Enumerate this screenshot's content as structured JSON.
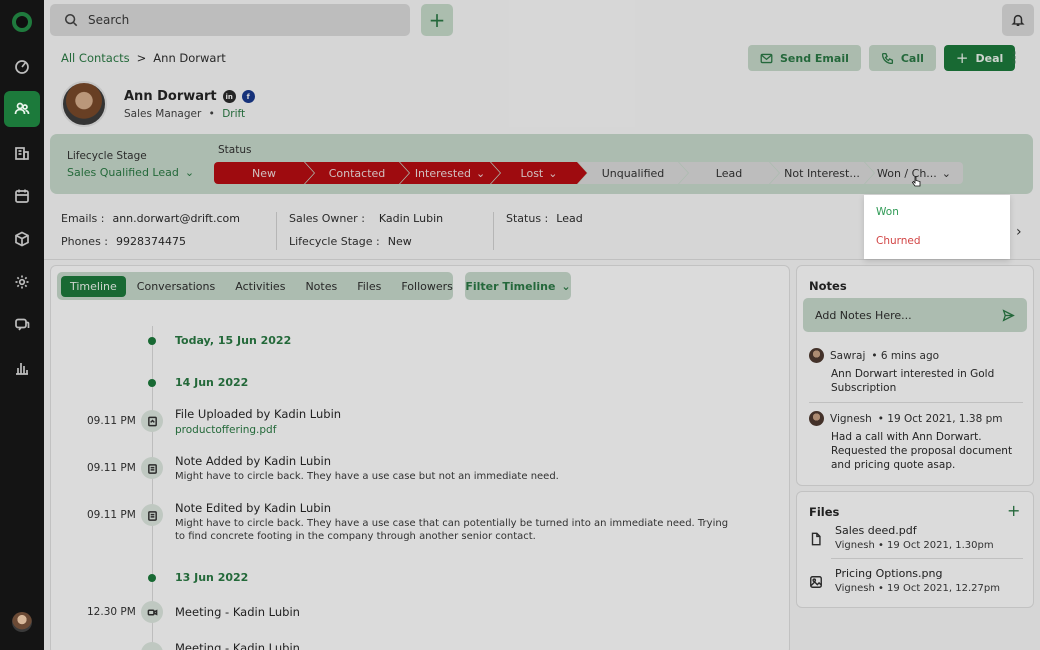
{
  "search": {
    "placeholder": "Search"
  },
  "breadcrumb": {
    "parent": "All Contacts",
    "separator": ">",
    "current": "Ann Dorwart"
  },
  "actions": {
    "send_email": "Send Email",
    "call": "Call",
    "deal": "Deal"
  },
  "contact": {
    "name": "Ann Dorwart",
    "linkedin": "in",
    "facebook": "f",
    "role": "Sales Manager",
    "role_sep": "•",
    "company": "Drift"
  },
  "lifecycle": {
    "label": "Lifecycle Stage",
    "value": "Sales Qualified Lead"
  },
  "status": {
    "label": "Status",
    "stages": [
      "New",
      "Contacted",
      "Interested",
      "Lost",
      "Unqualified",
      "Lead",
      "Not Interest...",
      "Won / Ch..."
    ]
  },
  "dropdown": {
    "won": "Won",
    "churned": "Churned"
  },
  "info": {
    "emails_label": "Emails :",
    "emails_value": "ann.dorwart@drift.com",
    "phones_label": "Phones :",
    "phones_value": "9928374475",
    "owner_label": "Sales Owner :",
    "owner_value": "Kadin Lubin",
    "lifecycle_label": "Lifecycle Stage :",
    "lifecycle_value": "New",
    "status_label": "Status :",
    "status_value": "Lead"
  },
  "tabs": [
    "Timeline",
    "Conversations",
    "Activities",
    "Notes",
    "Files",
    "Followers"
  ],
  "filter_label": "Filter Timeline",
  "timeline": {
    "date1": "Today, 15 Jun 2022",
    "date2": "14 Jun 2022",
    "e1_time": "09.11 PM",
    "e1_title": "File Uploaded by Kadin Lubin",
    "e1_link": "productoffering.pdf",
    "e2_time": "09.11 PM",
    "e2_title": "Note Added by Kadin Lubin",
    "e2_sub": "Might have to circle back. They have a use case but not an immediate need.",
    "e3_time": "09.11 PM",
    "e3_title": "Note Edited by Kadin Lubin",
    "e3_sub": "Might have to circle back. They have a use case that can potentially be turned into an immediate need. Trying to find concrete footing in the company through another senior contact.",
    "date3": "13 Jun 2022",
    "e4_time": "12.30 PM",
    "e4_title": "Meeting - Kadin Lubin",
    "e5_title": "Meeting - Kadin Lubin"
  },
  "notes": {
    "title": "Notes",
    "input_placeholder": "Add Notes Here...",
    "n1_author": "Sawraj",
    "n1_time": "• 6 mins ago",
    "n1_text": "Ann Dorwart interested in Gold Subscription",
    "n2_author": "Vignesh",
    "n2_time": "• 19 Oct 2021, 1.38 pm",
    "n2_text": "Had a call with Ann Dorwart. Requested the proposal document and pricing quote asap."
  },
  "files": {
    "title": "Files",
    "f1_name": "Sales deed.pdf",
    "f1_meta": "Vignesh • 19 Oct 2021, 1.30pm",
    "f2_name": "Pricing Options.png",
    "f2_meta": "Vignesh • 19 Oct 2021, 12.27pm"
  },
  "colors": {
    "brand": "#1d7b3c",
    "lost_red": "#b90d12",
    "won": "#2f9a55",
    "churned": "#d24545"
  }
}
